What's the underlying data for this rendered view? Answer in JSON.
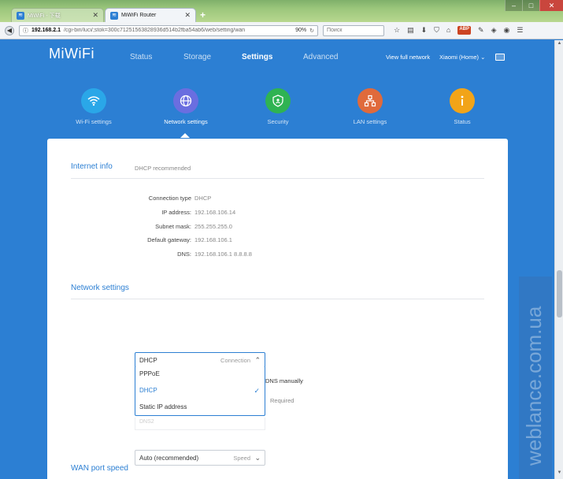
{
  "browser": {
    "tabs": [
      {
        "title": "MiWiFi - 下载"
      },
      {
        "title": "MiWiFi Router"
      }
    ],
    "new_tab": "+",
    "url_host": "192.168.2.1",
    "url_path": "/cgi-bin/luci/;stok=300c71251563828936d514b2fba54ab6/web/setting/wan",
    "zoom": "90%",
    "search_placeholder": "Поиск"
  },
  "header": {
    "logo": "MiWiFi",
    "nav": [
      "Status",
      "Storage",
      "Settings",
      "Advanced"
    ],
    "active_nav": "Settings",
    "view_network": "View full network",
    "device": "Xiaomi (Home)"
  },
  "features": [
    {
      "label": "Wi-Fi settings",
      "color": "#2aa7e8",
      "icon": "wifi-icon"
    },
    {
      "label": "Network settings",
      "color": "#6a6ee0",
      "icon": "globe-icon"
    },
    {
      "label": "Security",
      "color": "#2fb352",
      "icon": "shield-icon"
    },
    {
      "label": "LAN settings",
      "color": "#e06a3b",
      "icon": "network-icon"
    },
    {
      "label": "Status",
      "color": "#f2a418",
      "icon": "info-icon"
    }
  ],
  "internet_info": {
    "title": "Internet info",
    "subtitle": "DHCP recommended",
    "rows": [
      {
        "label": "Connection type",
        "value": "DHCP"
      },
      {
        "label": "IP address:",
        "value": "192.168.106.14"
      },
      {
        "label": "Subnet mask:",
        "value": "255.255.255.0"
      },
      {
        "label": "Default gateway:",
        "value": "192.168.106.1"
      },
      {
        "label": "DNS:",
        "value": "192.168.106.1 8.8.8.8"
      }
    ]
  },
  "network_settings": {
    "title": "Network settings",
    "connection_value": "DHCP",
    "connection_caption": "Connection",
    "options": [
      "PPPoE",
      "DHCP",
      "Static IP address"
    ],
    "selected_option": "DHCP",
    "dns_manually": "DNS manually",
    "required": "Required",
    "dns2_placeholder": "DNS2"
  },
  "wan_speed": {
    "title": "WAN port speed",
    "value": "Auto (recommended)",
    "caption": "Speed"
  },
  "watermark": "weblance.com.ua"
}
